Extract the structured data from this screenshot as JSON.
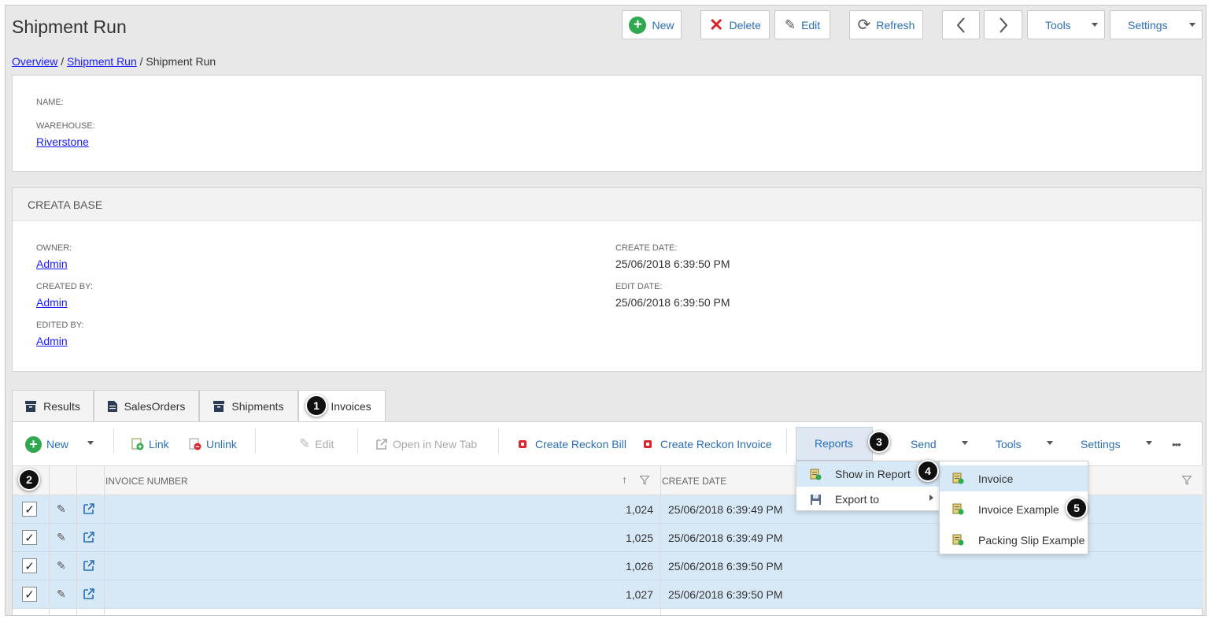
{
  "page": {
    "title": "Shipment Run",
    "breadcrumb": {
      "link1": "Overview",
      "sep1": " / ",
      "link2": "Shipment Run",
      "sep2": " / ",
      "current": "Shipment Run"
    }
  },
  "toolbar": {
    "new": "New",
    "delete": "Delete",
    "edit": "Edit",
    "refresh": "Refresh",
    "tools": "Tools",
    "settings": "Settings"
  },
  "details": {
    "name_label": "NAME:",
    "warehouse_label": "WAREHOUSE:",
    "warehouse_value": "Riverstone"
  },
  "creata_base": {
    "title": "CREATA BASE",
    "owner_label": "OWNER:",
    "owner_value": "Admin",
    "created_by_label": "CREATED BY:",
    "created_by_value": "Admin",
    "edited_by_label": "EDITED BY:",
    "edited_by_value": "Admin",
    "create_date_label": "CREATE DATE:",
    "create_date_value": "25/06/2018 6:39:50 PM",
    "edit_date_label": "EDIT DATE:",
    "edit_date_value": "25/06/2018 6:39:50 PM"
  },
  "tabs": [
    {
      "label": "Results"
    },
    {
      "label": "SalesOrders"
    },
    {
      "label": "Shipments"
    },
    {
      "label": "Invoices"
    }
  ],
  "grid_toolbar": {
    "new": "New",
    "link": "Link",
    "unlink": "Unlink",
    "edit": "Edit",
    "open_new_tab": "Open in New Tab",
    "create_bill": "Create Reckon Bill",
    "create_invoice": "Create Reckon Invoice",
    "reports": "Reports",
    "send": "Send",
    "tools": "Tools",
    "settings": "Settings",
    "more": "•••"
  },
  "grid": {
    "col_invoice_number": "INVOICE NUMBER",
    "col_create_date": "CREATE DATE",
    "rows": [
      {
        "number": "1,024",
        "date": "25/06/2018 6:39:49 PM",
        "checked": "✓"
      },
      {
        "number": "1,025",
        "date": "25/06/2018 6:39:49 PM",
        "checked": "✓"
      },
      {
        "number": "1,026",
        "date": "25/06/2018 6:39:50 PM",
        "checked": "✓"
      },
      {
        "number": "1,027",
        "date": "25/06/2018 6:39:50 PM",
        "checked": "✓"
      }
    ]
  },
  "reports_menu": {
    "show_in_report": "Show in Report",
    "export_to": "Export to"
  },
  "report_submenu": {
    "items": [
      "Invoice",
      "Invoice Example",
      "Packing Slip Example"
    ]
  },
  "badges": [
    "1",
    "2",
    "3",
    "4",
    "5"
  ],
  "colors": {
    "accent": "#2a6fb8",
    "row_selected": "#d7e8f7",
    "delete": "#d9262c",
    "new": "#2fa84f"
  }
}
